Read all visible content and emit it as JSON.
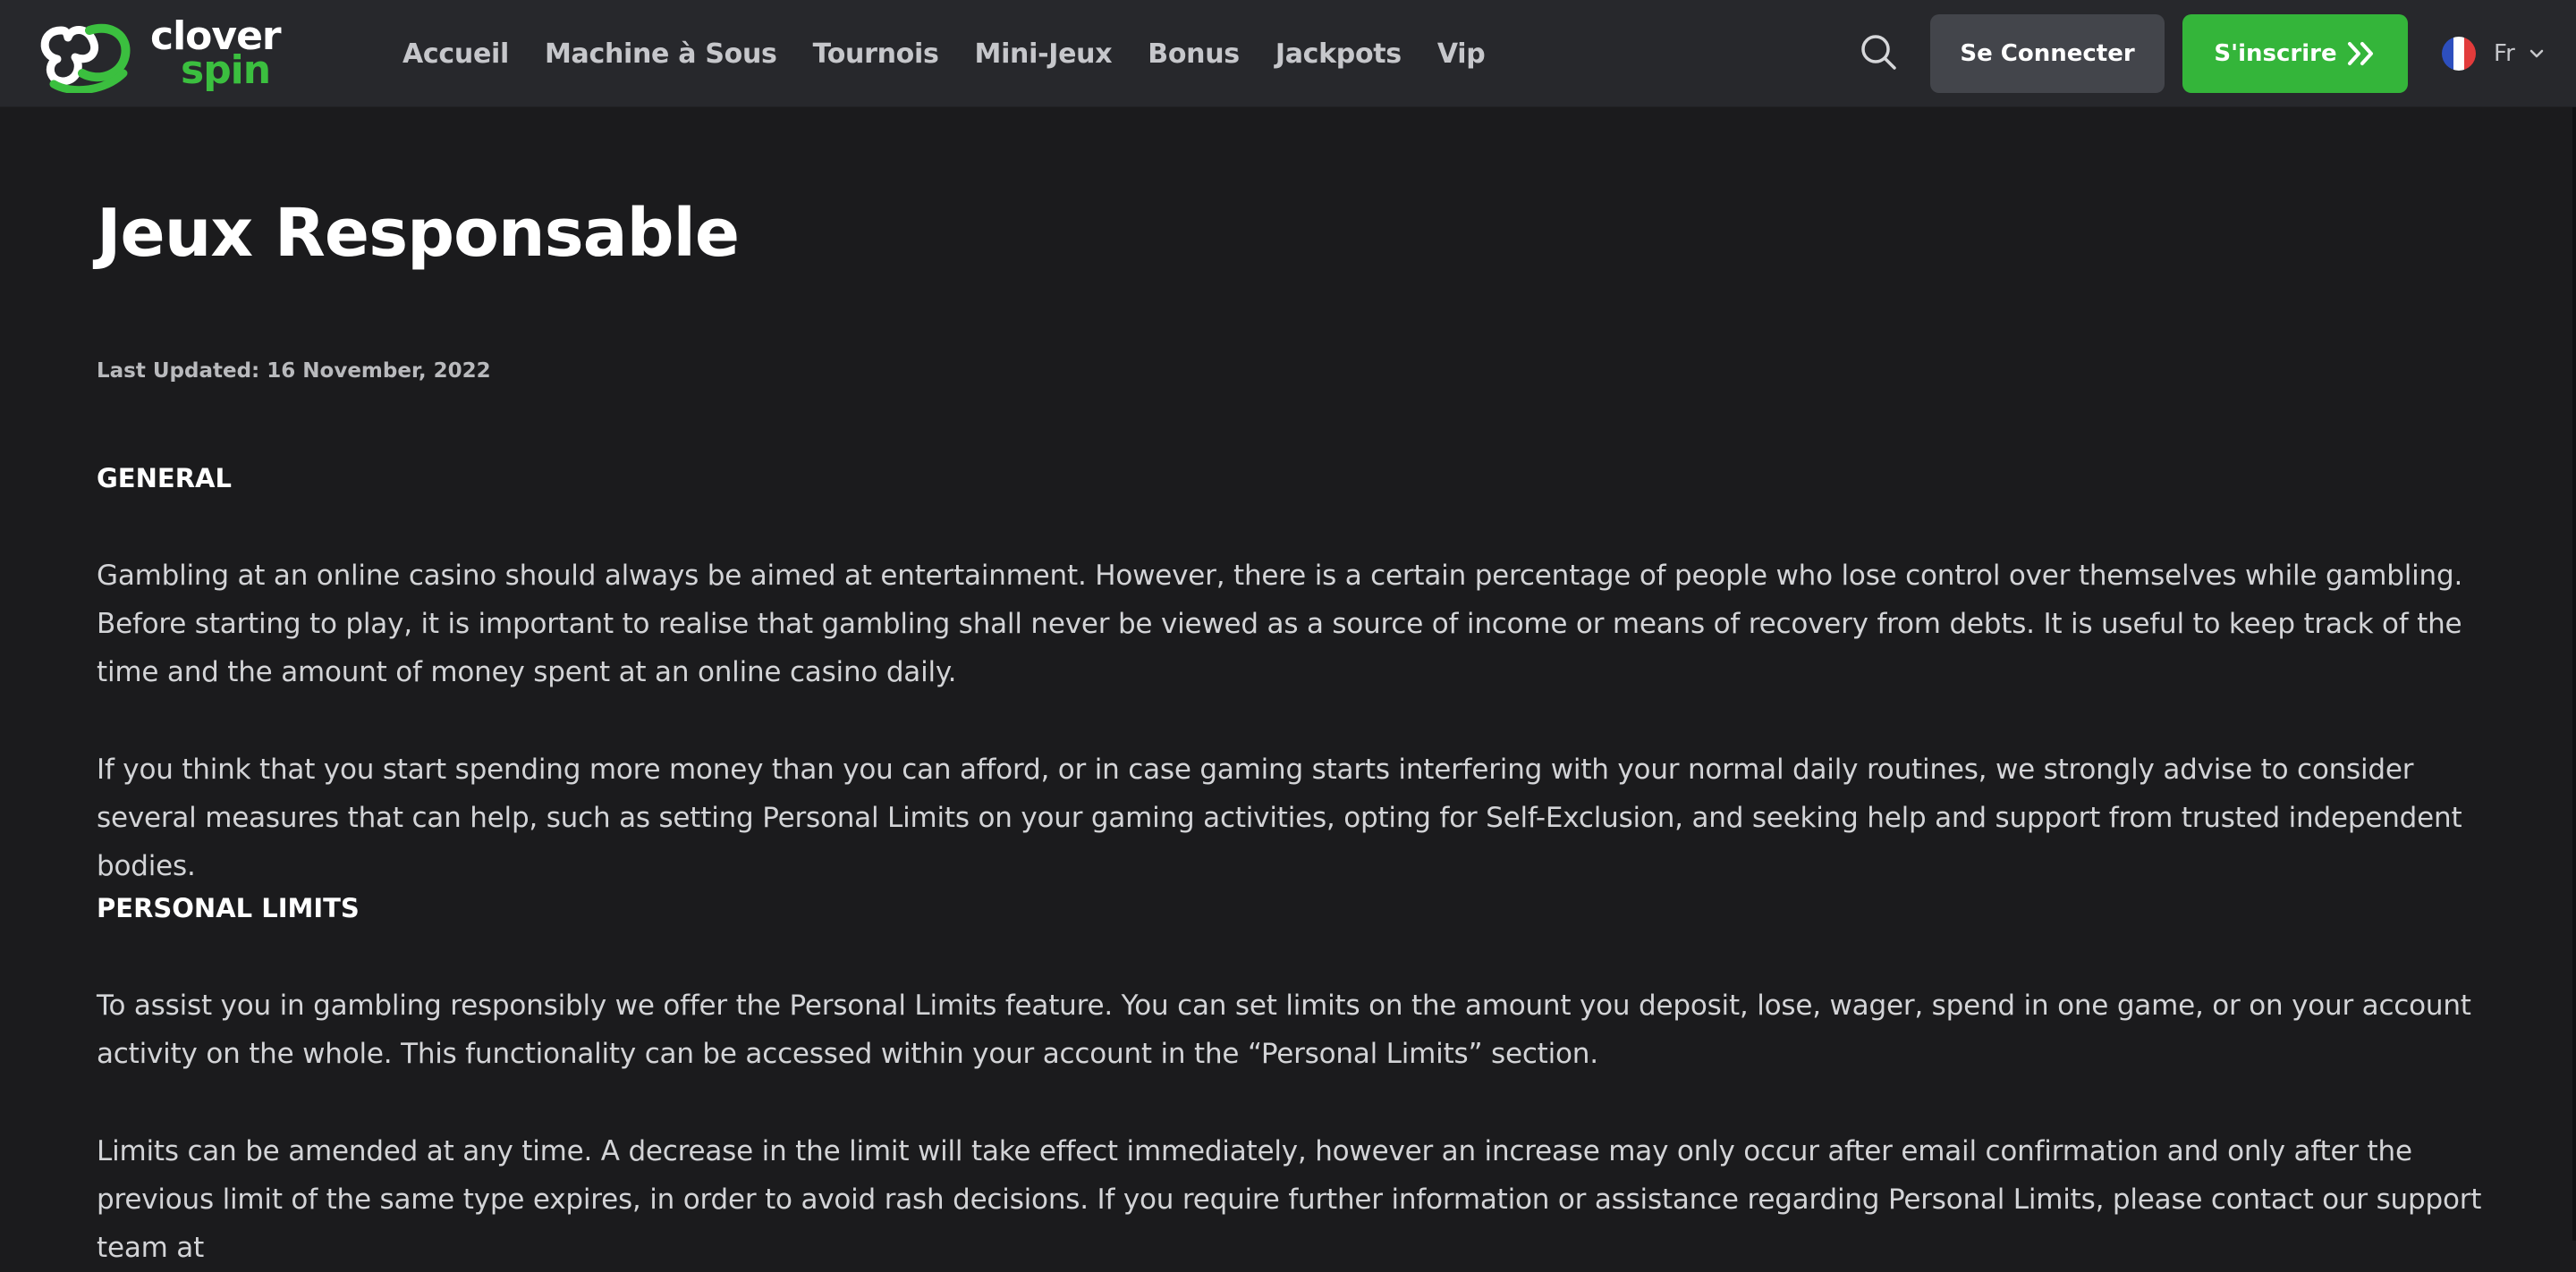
{
  "brand": {
    "name_line1": "clover",
    "name_line2": "spin",
    "accent_color": "#34b53a"
  },
  "nav": {
    "items": [
      {
        "label": "Accueil"
      },
      {
        "label": "Machine à Sous"
      },
      {
        "label": "Tournois"
      },
      {
        "label": "Mini-Jeux"
      },
      {
        "label": "Bonus"
      },
      {
        "label": "Jackpots"
      },
      {
        "label": "Vip"
      }
    ]
  },
  "header": {
    "search_icon": "search-icon",
    "login_label": "Se Connecter",
    "signup_label": "S'inscrire",
    "language": {
      "label": "Fr",
      "flag_icon": "france-flag-icon"
    }
  },
  "page": {
    "title": "Jeux Responsable",
    "last_updated": "Last Updated: 16 November, 2022",
    "sections": [
      {
        "heading": "GENERAL",
        "paragraphs": [
          "Gambling at an online casino should always be aimed at entertainment. However, there is a certain percentage of people who lose control over themselves while gambling. Before starting to play, it is important to realise that gambling shall never be viewed as a source of income or means of recovery from debts. It is useful to keep track of the time and the amount of money spent at an online casino daily.",
          "If you think that you start spending more money than you can afford, or in case gaming starts interfering with your normal daily routines, we strongly advise to consider several measures that can help, such as setting Personal Limits on your gaming activities, opting for Self-Exclusion, and seeking help and support from trusted independent bodies."
        ]
      },
      {
        "heading": "PERSONAL LIMITS",
        "paragraphs": [
          "To assist you in gambling responsibly we offer the Personal Limits feature. You can set limits on the amount you deposit, lose, wager, spend in one game, or on your account activity on the whole. This functionality can be accessed within your account in the “Personal Limits” section.",
          "Limits can be amended at any time. A decrease in the limit will take effect immediately, however an increase may only occur after email confirmation and only after the previous limit of the same type expires, in order to avoid rash decisions. If you require further information or assistance regarding Personal Limits, please contact our support team at"
        ]
      }
    ]
  }
}
